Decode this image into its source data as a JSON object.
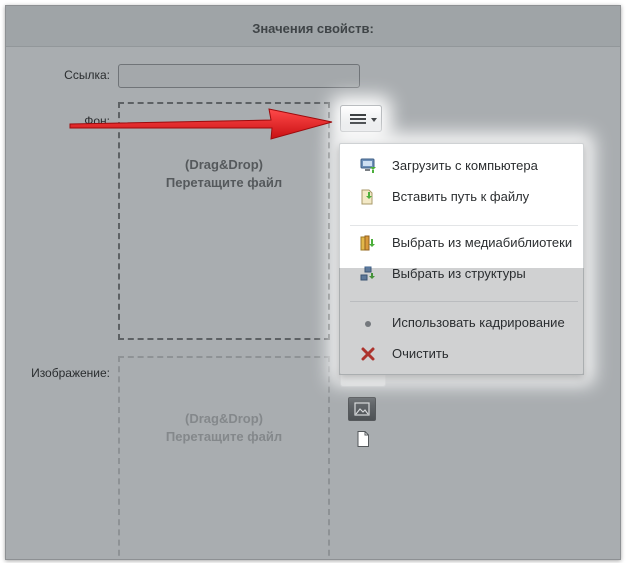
{
  "panel": {
    "title": "Значения свойств:"
  },
  "fields": {
    "link_label": "Ссылка:",
    "bg_label": "Фон:",
    "image_label": "Изображение:"
  },
  "dropzone": {
    "line1": "(Drag&Drop)",
    "line2": "Перетащите файл"
  },
  "menu": {
    "button_icon": "hamburger-icon",
    "items": [
      {
        "label": "Загрузить с компьютера",
        "icon": "computer-upload-icon"
      },
      {
        "label": "Вставить путь к файлу",
        "icon": "file-path-icon"
      },
      {
        "label": "Выбрать из медиабиблиотеки",
        "icon": "media-library-icon"
      },
      {
        "label": "Выбрать из структуры",
        "icon": "structure-icon"
      },
      {
        "label": "Использовать кадрирование",
        "icon": "crop-dot-icon"
      },
      {
        "label": "Очистить",
        "icon": "clear-x-icon"
      }
    ]
  },
  "colors": {
    "background": "#a9adb0",
    "arrow": "#e8191c",
    "clear_icon": "#d2352c",
    "menu_bg": "#ffffff"
  }
}
